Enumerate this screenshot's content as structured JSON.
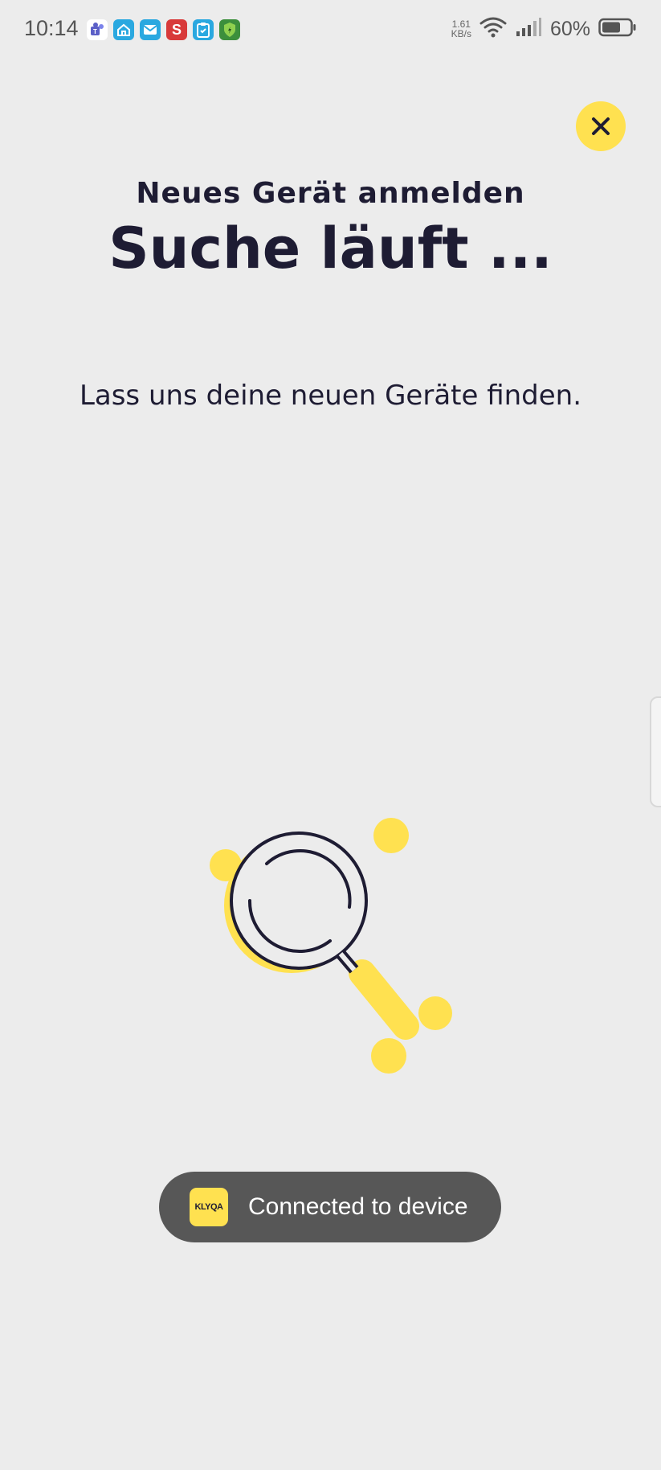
{
  "status_bar": {
    "time": "10:14",
    "net_speed_value": "1.61",
    "net_speed_unit": "KB/s",
    "battery_percent": "60%",
    "app_icons": [
      {
        "name": "teams-icon",
        "color": "#5b5fc7"
      },
      {
        "name": "home-app-icon",
        "color": "#2aa8e0"
      },
      {
        "name": "mail-icon",
        "color": "#2aa8e0"
      },
      {
        "name": "s-app-icon",
        "color": "#d83a3a",
        "glyph": "S"
      },
      {
        "name": "clipboard-app-icon",
        "color": "#2aa8e0"
      },
      {
        "name": "shield-app-icon",
        "color": "#3c8f3c"
      }
    ]
  },
  "header": {
    "subtitle": "Neues Gerät anmelden",
    "title": "Suche läuft ..."
  },
  "main": {
    "description": "Lass uns deine neuen Geräte finden."
  },
  "toast": {
    "logo_text": "KLYQA",
    "message": "Connected to device"
  },
  "colors": {
    "accent": "#ffe150",
    "text": "#1e1c33",
    "background": "#ececec",
    "toast_bg": "#575757"
  }
}
